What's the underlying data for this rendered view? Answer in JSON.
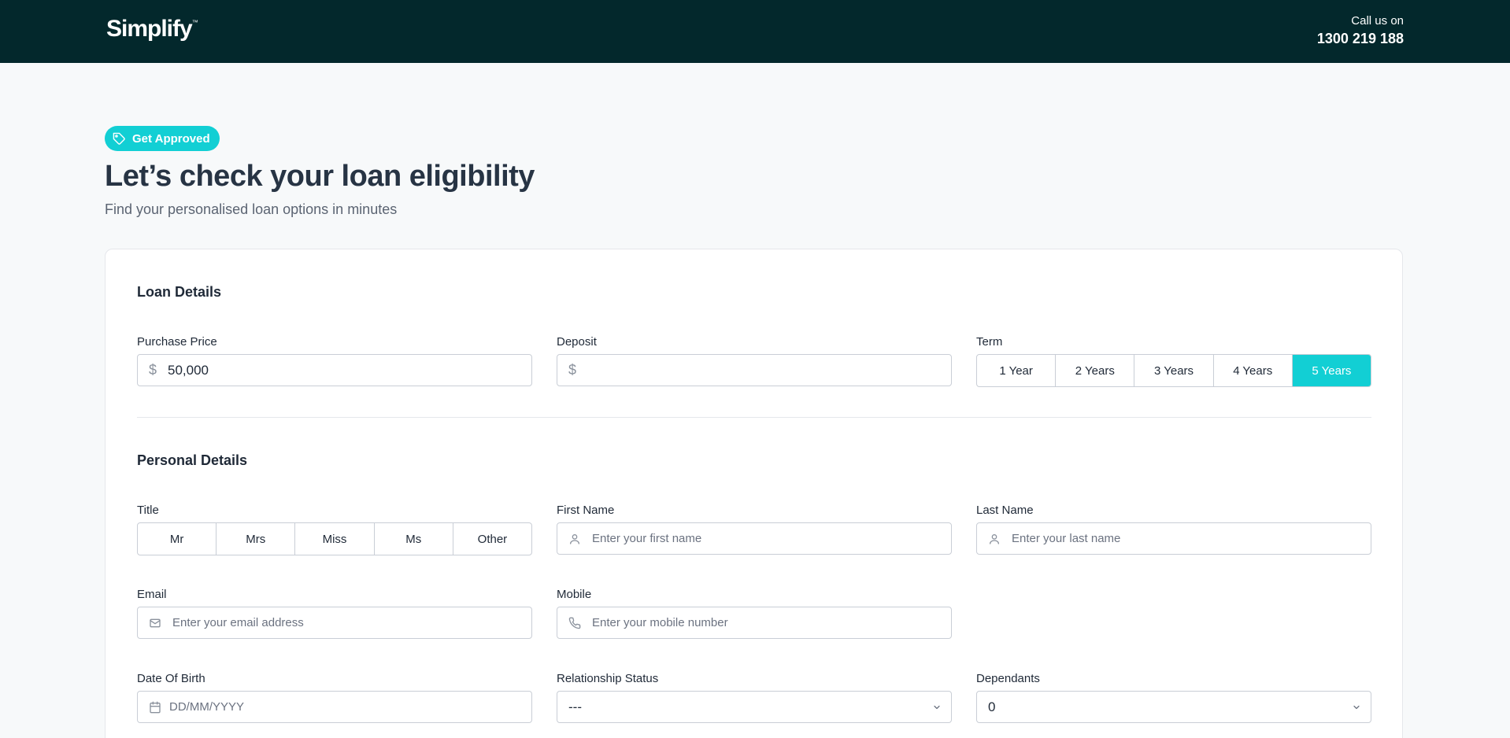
{
  "header": {
    "logo_text": "Simplify",
    "logo_mark": "™",
    "call_label": "Call us on",
    "phone": "1300 219 188"
  },
  "hero": {
    "badge": "Get Approved",
    "title": "Let’s check your loan eligibility",
    "subtitle": "Find your personalised loan options in minutes"
  },
  "loan": {
    "section_title": "Loan Details",
    "purchase_price_label": "Purchase Price",
    "purchase_price_prefix": "$",
    "purchase_price_value": "50,000",
    "deposit_label": "Deposit",
    "deposit_prefix": "$",
    "term_label": "Term",
    "term_options": [
      "1 Year",
      "2 Years",
      "3 Years",
      "4 Years",
      "5 Years"
    ],
    "term_selected": "5 Years"
  },
  "personal": {
    "section_title": "Personal Details",
    "title_label": "Title",
    "title_options": [
      "Mr",
      "Mrs",
      "Miss",
      "Ms",
      "Other"
    ],
    "first_name_label": "First Name",
    "first_name_placeholder": "Enter your first name",
    "last_name_label": "Last Name",
    "last_name_placeholder": "Enter your last name",
    "email_label": "Email",
    "email_placeholder": "Enter your email address",
    "mobile_label": "Mobile",
    "mobile_placeholder": "Enter your mobile number",
    "dob_label": "Date Of Birth",
    "dob_placeholder": "DD/MM/YYYY",
    "relationship_label": "Relationship Status",
    "relationship_value": "---",
    "dependants_label": "Dependants",
    "dependants_value": "0"
  },
  "colors": {
    "header_bg": "#03282c",
    "accent": "#12cfd4"
  }
}
